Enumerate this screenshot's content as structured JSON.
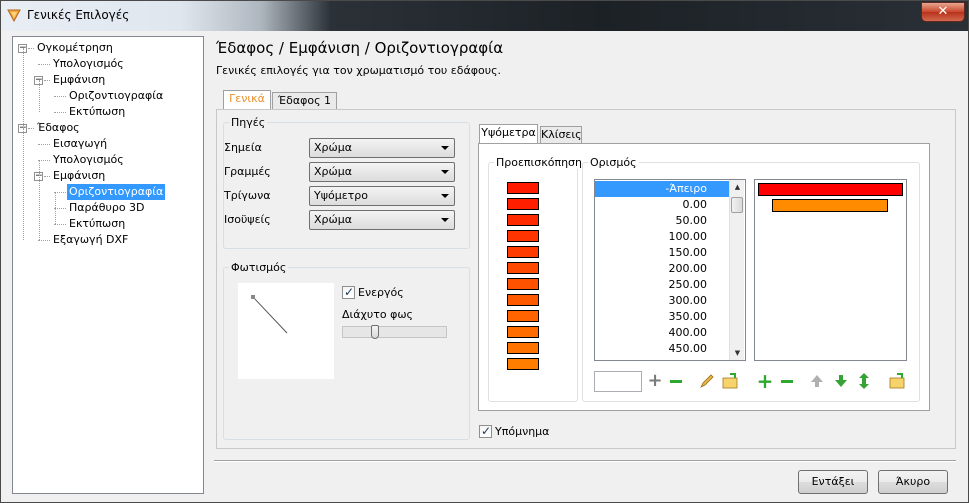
{
  "window": {
    "title": "Γενικές Επιλογές",
    "close_label": "✕"
  },
  "tree": {
    "items": [
      {
        "label": "Ογκομέτρηση",
        "expander": "−"
      },
      {
        "label": "Υπολογισμός"
      },
      {
        "label": "Εμφάνιση",
        "expander": "−"
      },
      {
        "label": "Οριζοντιογραφία"
      },
      {
        "label": "Εκτύπωση"
      },
      {
        "label": "Έδαφος",
        "expander": "−"
      },
      {
        "label": "Εισαγωγή"
      },
      {
        "label": "Υπολογισμός"
      },
      {
        "label": "Εμφάνιση",
        "expander": "−"
      },
      {
        "label": "Οριζοντιογραφία",
        "selected": true
      },
      {
        "label": "Παράθυρο 3D"
      },
      {
        "label": "Εκτύπωση"
      },
      {
        "label": "Εξαγωγή DXF"
      }
    ]
  },
  "header": {
    "title": "Έδαφος / Εμφάνιση / Οριζοντιογραφία",
    "subtitle": "Γενικές επιλογές για τον χρωματισμό του εδάφους."
  },
  "tabs": [
    "Γενικά",
    "Έδαφος 1"
  ],
  "sources": {
    "title": "Πηγές",
    "rows": [
      {
        "label": "Σημεία",
        "value": "Χρώμα"
      },
      {
        "label": "Γραμμές",
        "value": "Χρώμα"
      },
      {
        "label": "Τρίγωνα",
        "value": "Υψόμετρο"
      },
      {
        "label": "Ισοϋψείς",
        "value": "Χρώμα"
      }
    ]
  },
  "lighting": {
    "title": "Φωτισμός",
    "active_label": "Ενεργός",
    "active_checked": true,
    "ambient_label": "Διάχυτο φως",
    "ambient_level": 0.3
  },
  "inner_tabs": [
    "Υψόμετρα",
    "Κλίσεις"
  ],
  "preview": {
    "title": "Προεπισκόπηση",
    "swatches": [
      "#ff1a00",
      "#ff1e00",
      "#ff2a00",
      "#ff3400",
      "#ff3c00",
      "#ff4800",
      "#ff5200",
      "#ff5a00",
      "#ff6400",
      "#ff6c00",
      "#ff7400",
      "#ff7e00"
    ]
  },
  "definition": {
    "title": "Ορισμός",
    "values": [
      "-Άπειρο",
      "0.00",
      "50.00",
      "100.00",
      "150.00",
      "200.00",
      "250.00",
      "300.00",
      "350.00",
      "400.00",
      "450.00"
    ],
    "selected_index": 0,
    "bars": [
      {
        "color": "#ff0000"
      },
      {
        "color": "#ff8c00"
      }
    ],
    "input_value": ""
  },
  "legend": {
    "label": "Υπόμνημα",
    "checked": true
  },
  "icons": {
    "add": "plus-icon",
    "remove": "minus-icon",
    "edit": "pencil-icon",
    "folder": "folder-icon",
    "up": "arrow-up-icon",
    "down": "arrow-down-icon",
    "updown": "arrow-updown-icon"
  },
  "colors": {
    "accent": "#3399ff",
    "add_green": "#2fa82f",
    "arrow_green": "#35a335"
  },
  "buttons": {
    "ok": "Εντάξει",
    "cancel": "Άκυρο"
  }
}
